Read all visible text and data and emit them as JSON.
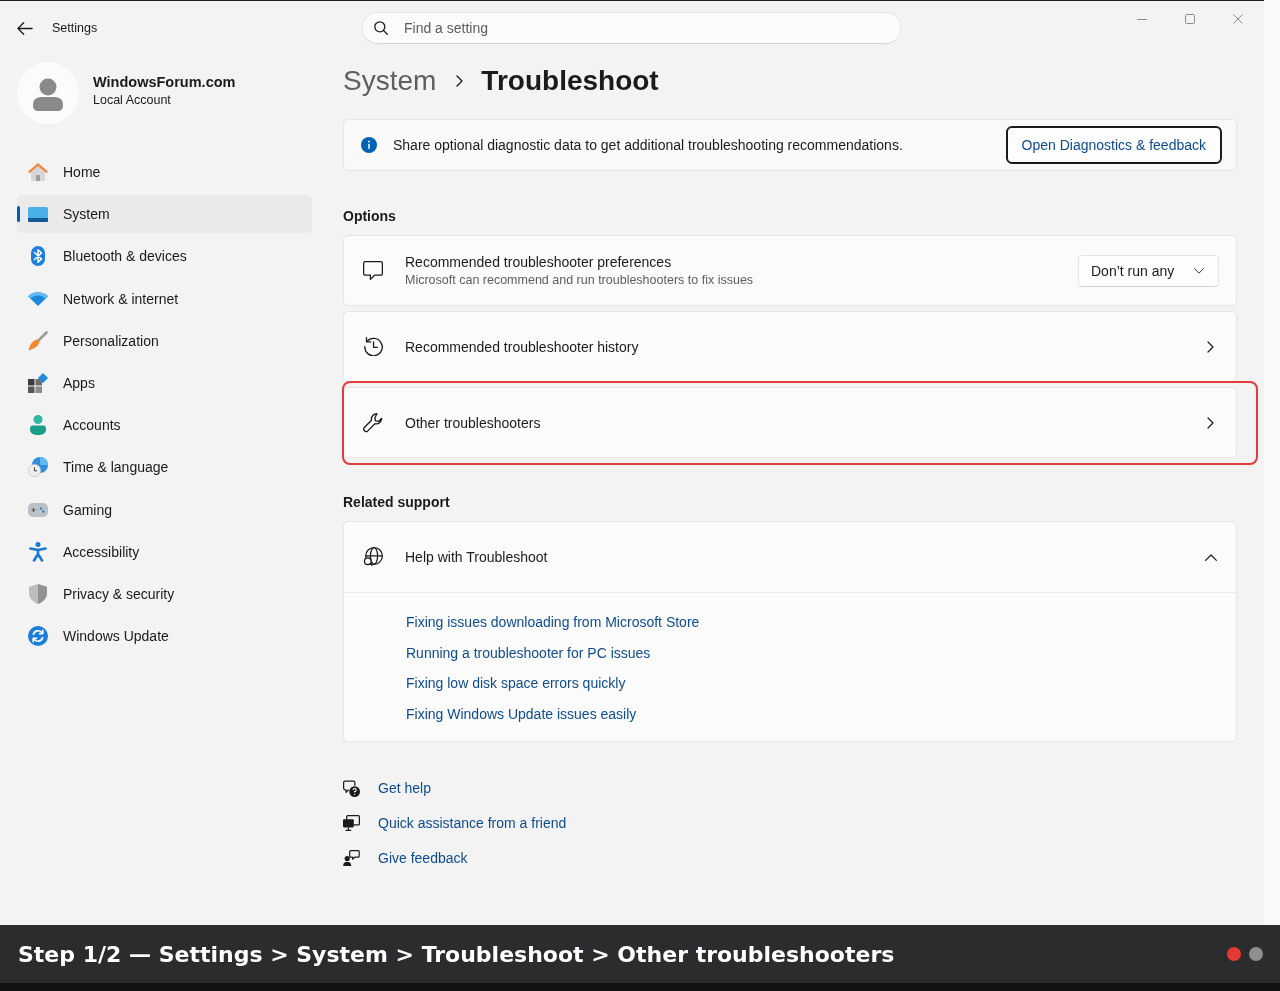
{
  "window": {
    "title": "Settings"
  },
  "search": {
    "placeholder": "Find a setting"
  },
  "profile": {
    "name": "WindowsForum.com",
    "account_type": "Local Account"
  },
  "sidebar": {
    "items": [
      {
        "label": "Home",
        "selected": false
      },
      {
        "label": "System",
        "selected": true
      },
      {
        "label": "Bluetooth & devices",
        "selected": false
      },
      {
        "label": "Network & internet",
        "selected": false
      },
      {
        "label": "Personalization",
        "selected": false
      },
      {
        "label": "Apps",
        "selected": false
      },
      {
        "label": "Accounts",
        "selected": false
      },
      {
        "label": "Time & language",
        "selected": false
      },
      {
        "label": "Gaming",
        "selected": false
      },
      {
        "label": "Accessibility",
        "selected": false
      },
      {
        "label": "Privacy & security",
        "selected": false
      },
      {
        "label": "Windows Update",
        "selected": false
      }
    ]
  },
  "breadcrumb": [
    {
      "label": "System",
      "current": false
    },
    {
      "label": "Troubleshoot",
      "current": true
    }
  ],
  "info_bar": {
    "message": "Share optional diagnostic data to get additional troubleshooting recommendations.",
    "button": {
      "label": "Open Diagnostics & feedback",
      "focused": true
    }
  },
  "options": {
    "heading": "Options",
    "items": [
      {
        "kind": "dropdown",
        "title": "Recommended troubleshooter preferences",
        "subtitle": "Microsoft can recommend and run troubleshooters to fix issues",
        "value": "Don’t run any",
        "highlighted": false
      },
      {
        "kind": "link",
        "title": "Recommended troubleshooter history",
        "highlighted": false
      },
      {
        "kind": "link",
        "title": "Other troubleshooters",
        "highlighted": true
      }
    ]
  },
  "related_support": {
    "heading": "Related support",
    "expander": {
      "title": "Help with Troubleshoot",
      "expanded": true,
      "links": [
        "Fixing issues downloading from Microsoft Store",
        "Running a troubleshooter for PC issues",
        "Fixing low disk space errors quickly",
        "Fixing Windows Update issues easily"
      ]
    }
  },
  "help_links": [
    "Get help",
    "Quick assistance from a friend",
    "Give feedback"
  ],
  "caption": {
    "text": "Step 1/2 — Settings > System > Troubleshoot > Other troubleshooters",
    "steps": [
      {
        "selected": true
      },
      {
        "selected": false
      }
    ]
  }
}
